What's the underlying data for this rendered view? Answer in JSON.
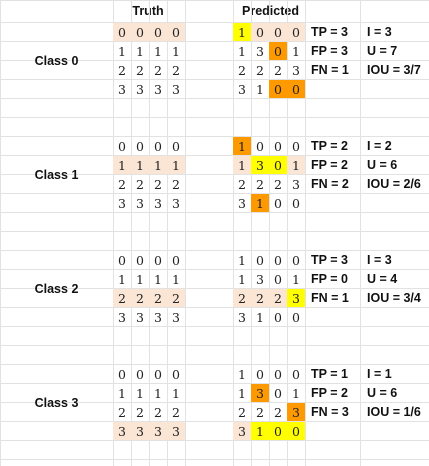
{
  "headers": {
    "truth": "Truth",
    "predicted": "Predicted"
  },
  "colors": {
    "truth_highlight": "#fbe5d5",
    "tp_yellow": "#ffff00",
    "fp_orange": "#ff9900",
    "grid": "#e2e2e2"
  },
  "classes": [
    {
      "label": "Class 0",
      "truth": [
        [
          "0",
          "0",
          "0",
          "0"
        ],
        [
          "1",
          "1",
          "1",
          "1"
        ],
        [
          "2",
          "2",
          "2",
          "2"
        ],
        [
          "3",
          "3",
          "3",
          "3"
        ]
      ],
      "truth_highlight_row": 0,
      "predicted": [
        [
          "1",
          "0",
          "0",
          "0"
        ],
        [
          "1",
          "3",
          "0",
          "1"
        ],
        [
          "2",
          "2",
          "2",
          "3"
        ],
        [
          "3",
          "1",
          "0",
          "0"
        ]
      ],
      "predicted_colors": [
        [
          "Y",
          "H",
          "H",
          "H"
        ],
        [
          "",
          "",
          "O",
          ""
        ],
        [
          "",
          "",
          "",
          ""
        ],
        [
          "",
          "",
          "O",
          "O"
        ]
      ],
      "stats": {
        "tp": "TP = 3",
        "i": "I = 3",
        "fp": "FP = 3",
        "u": "U = 7",
        "fn": "FN = 1",
        "iou": "IOU = 3/7"
      }
    },
    {
      "label": "Class 1",
      "truth": [
        [
          "0",
          "0",
          "0",
          "0"
        ],
        [
          "1",
          "1",
          "1",
          "1"
        ],
        [
          "2",
          "2",
          "2",
          "2"
        ],
        [
          "3",
          "3",
          "3",
          "3"
        ]
      ],
      "truth_highlight_row": 1,
      "predicted": [
        [
          "1",
          "0",
          "0",
          "0"
        ],
        [
          "1",
          "3",
          "0",
          "1"
        ],
        [
          "2",
          "2",
          "2",
          "3"
        ],
        [
          "3",
          "1",
          "0",
          "0"
        ]
      ],
      "predicted_colors": [
        [
          "O",
          "",
          "",
          ""
        ],
        [
          "H",
          "Y",
          "Y",
          "H"
        ],
        [
          "",
          "",
          "",
          ""
        ],
        [
          "",
          "O",
          "",
          ""
        ]
      ],
      "stats": {
        "tp": "TP = 2",
        "i": "I = 2",
        "fp": "FP = 2",
        "u": "U = 6",
        "fn": "FN = 2",
        "iou": "IOU = 2/6"
      }
    },
    {
      "label": "Class 2",
      "truth": [
        [
          "0",
          "0",
          "0",
          "0"
        ],
        [
          "1",
          "1",
          "1",
          "1"
        ],
        [
          "2",
          "2",
          "2",
          "2"
        ],
        [
          "3",
          "3",
          "3",
          "3"
        ]
      ],
      "truth_highlight_row": 2,
      "predicted": [
        [
          "1",
          "0",
          "0",
          "0"
        ],
        [
          "1",
          "3",
          "0",
          "1"
        ],
        [
          "2",
          "2",
          "2",
          "3"
        ],
        [
          "3",
          "1",
          "0",
          "0"
        ]
      ],
      "predicted_colors": [
        [
          "",
          "",
          "",
          ""
        ],
        [
          "",
          "",
          "",
          ""
        ],
        [
          "H",
          "H",
          "H",
          "Y"
        ],
        [
          "",
          "",
          "",
          ""
        ]
      ],
      "stats": {
        "tp": "TP = 3",
        "i": "I = 3",
        "fp": "FP = 0",
        "u": "U = 4",
        "fn": "FN = 1",
        "iou": "IOU = 3/4"
      }
    },
    {
      "label": "Class 3",
      "truth": [
        [
          "0",
          "0",
          "0",
          "0"
        ],
        [
          "1",
          "1",
          "1",
          "1"
        ],
        [
          "2",
          "2",
          "2",
          "2"
        ],
        [
          "3",
          "3",
          "3",
          "3"
        ]
      ],
      "truth_highlight_row": 3,
      "predicted": [
        [
          "1",
          "0",
          "0",
          "0"
        ],
        [
          "1",
          "3",
          "0",
          "1"
        ],
        [
          "2",
          "2",
          "2",
          "3"
        ],
        [
          "3",
          "1",
          "0",
          "0"
        ]
      ],
      "predicted_colors": [
        [
          "",
          "",
          "",
          ""
        ],
        [
          "",
          "O",
          "",
          ""
        ],
        [
          "",
          "",
          "",
          "O"
        ],
        [
          "H",
          "Y",
          "Y",
          "Y"
        ]
      ],
      "stats": {
        "tp": "TP = 1",
        "i": "I = 1",
        "fp": "FP = 2",
        "u": "U = 6",
        "fn": "FN = 3",
        "iou": "IOU = 1/6"
      }
    }
  ]
}
